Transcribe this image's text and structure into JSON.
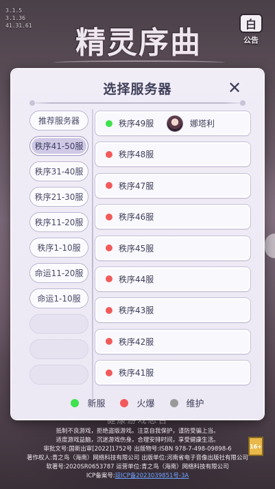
{
  "version_lines": [
    "3.1.5",
    "3.1.36",
    "41.31.61"
  ],
  "logo_text": "精灵序曲",
  "announce_label": "公告",
  "announce_icon_text": "白",
  "modal": {
    "title": "选择服务器",
    "close_icon": "✕"
  },
  "categories": [
    {
      "label": "推荐服务器",
      "active": false
    },
    {
      "label": "秩序41-50服",
      "active": true
    },
    {
      "label": "秩序31-40服",
      "active": false
    },
    {
      "label": "秩序21-30服",
      "active": false
    },
    {
      "label": "秩序11-20服",
      "active": false
    },
    {
      "label": "秩序1-10服",
      "active": false
    },
    {
      "label": "命运11-20服",
      "active": false
    },
    {
      "label": "命运1-10服",
      "active": false
    },
    {
      "label": "",
      "active": false
    },
    {
      "label": "",
      "active": false
    },
    {
      "label": "",
      "active": false
    }
  ],
  "servers": [
    {
      "name": "秩序49服",
      "status": "new",
      "character": "娜塔利"
    },
    {
      "name": "秩序48服",
      "status": "hot"
    },
    {
      "name": "秩序47服",
      "status": "hot"
    },
    {
      "name": "秩序46服",
      "status": "hot"
    },
    {
      "name": "秩序45服",
      "status": "hot"
    },
    {
      "name": "秩序44服",
      "status": "hot"
    },
    {
      "name": "秩序43服",
      "status": "hot"
    },
    {
      "name": "秩序42服",
      "status": "hot"
    },
    {
      "name": "秩序41服",
      "status": "hot"
    }
  ],
  "legend": {
    "new_label": "新服",
    "hot_label": "火爆",
    "maint_label": "维护"
  },
  "colors": {
    "new": "#3ee24e",
    "hot": "#f25a5a",
    "maint": "#9a9a9a"
  },
  "footer": {
    "slogan": "健康游戏忠告",
    "line1": "抵制不良游戏，拒绝盗版游戏。注意自我保护，谨防受骗上当。",
    "line2": "适度游戏益脑，沉迷游戏伤身。合理安排时间，享受健康生活。",
    "line3": "审批文号:国新出审[2022]1752号 出版物号:ISBN 978-7-498-09898-6",
    "line4": "著作权人:青之鸟（海南）网络科技有限公司 出版单位:河南省电子音像出版社有限公司",
    "line5": "软著号:2020SR0653787 运营单位:青之鸟（海南）网络科技有限公司",
    "line6_prefix": "ICP备案号:",
    "line6_link": "琼ICP备2023039851号-3A",
    "age_rating": "16+"
  }
}
